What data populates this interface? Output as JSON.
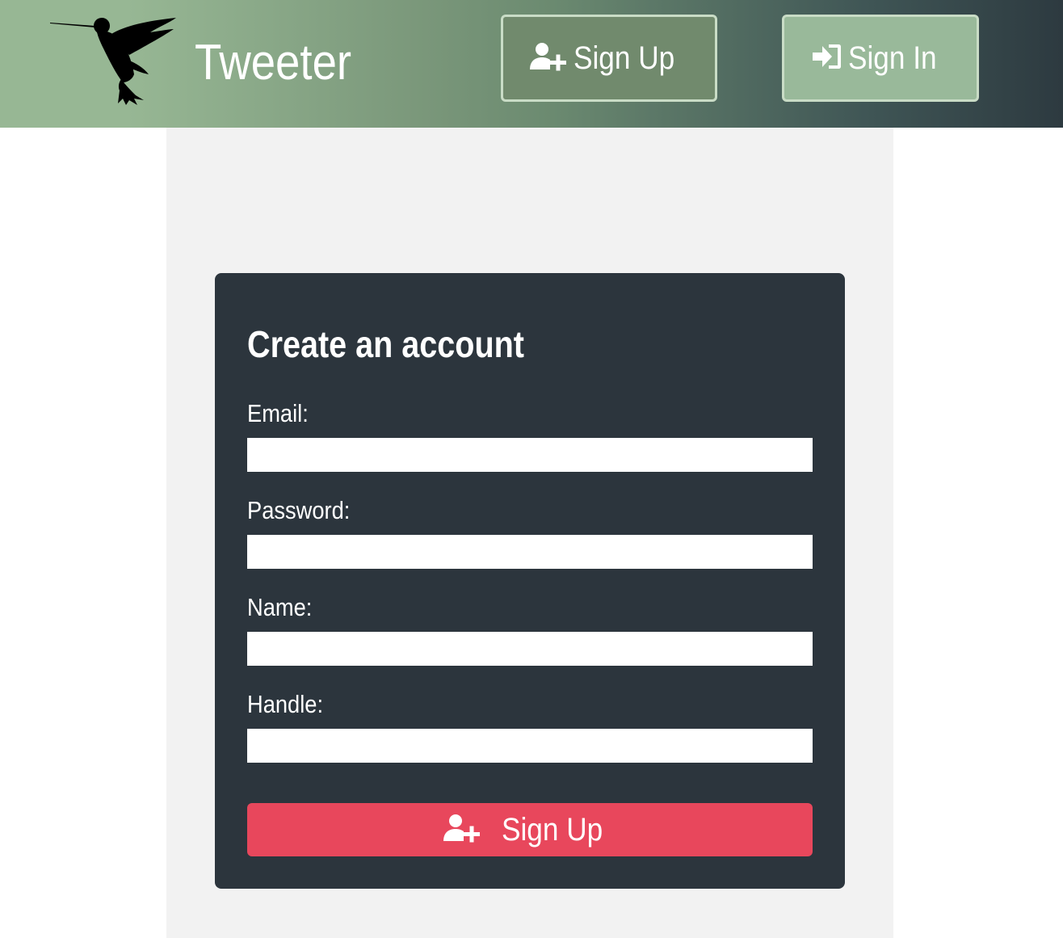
{
  "header": {
    "logo_icon": "hummingbird-logo-icon",
    "brand": "Tweeter",
    "nav": {
      "sign_up_label": "Sign Up",
      "sign_up_icon": "user-plus-icon",
      "sign_in_label": "Sign In",
      "sign_in_icon": "sign-in-icon"
    }
  },
  "form": {
    "title": "Create an account",
    "fields": [
      {
        "label": "Email:",
        "value": "",
        "placeholder": ""
      },
      {
        "label": "Password:",
        "value": "",
        "placeholder": ""
      },
      {
        "label": "Name:",
        "value": "",
        "placeholder": ""
      },
      {
        "label": "Handle:",
        "value": "",
        "placeholder": ""
      }
    ],
    "submit_label": "Sign Up",
    "submit_icon": "user-plus-icon"
  },
  "colors": {
    "header_gradient_start": "#97b794",
    "header_gradient_end": "#2d3a40",
    "page_panel": "#f2f2f2",
    "card": "#2c353d",
    "submit": "#e8475c",
    "nav_border": "#c9dcc6"
  }
}
